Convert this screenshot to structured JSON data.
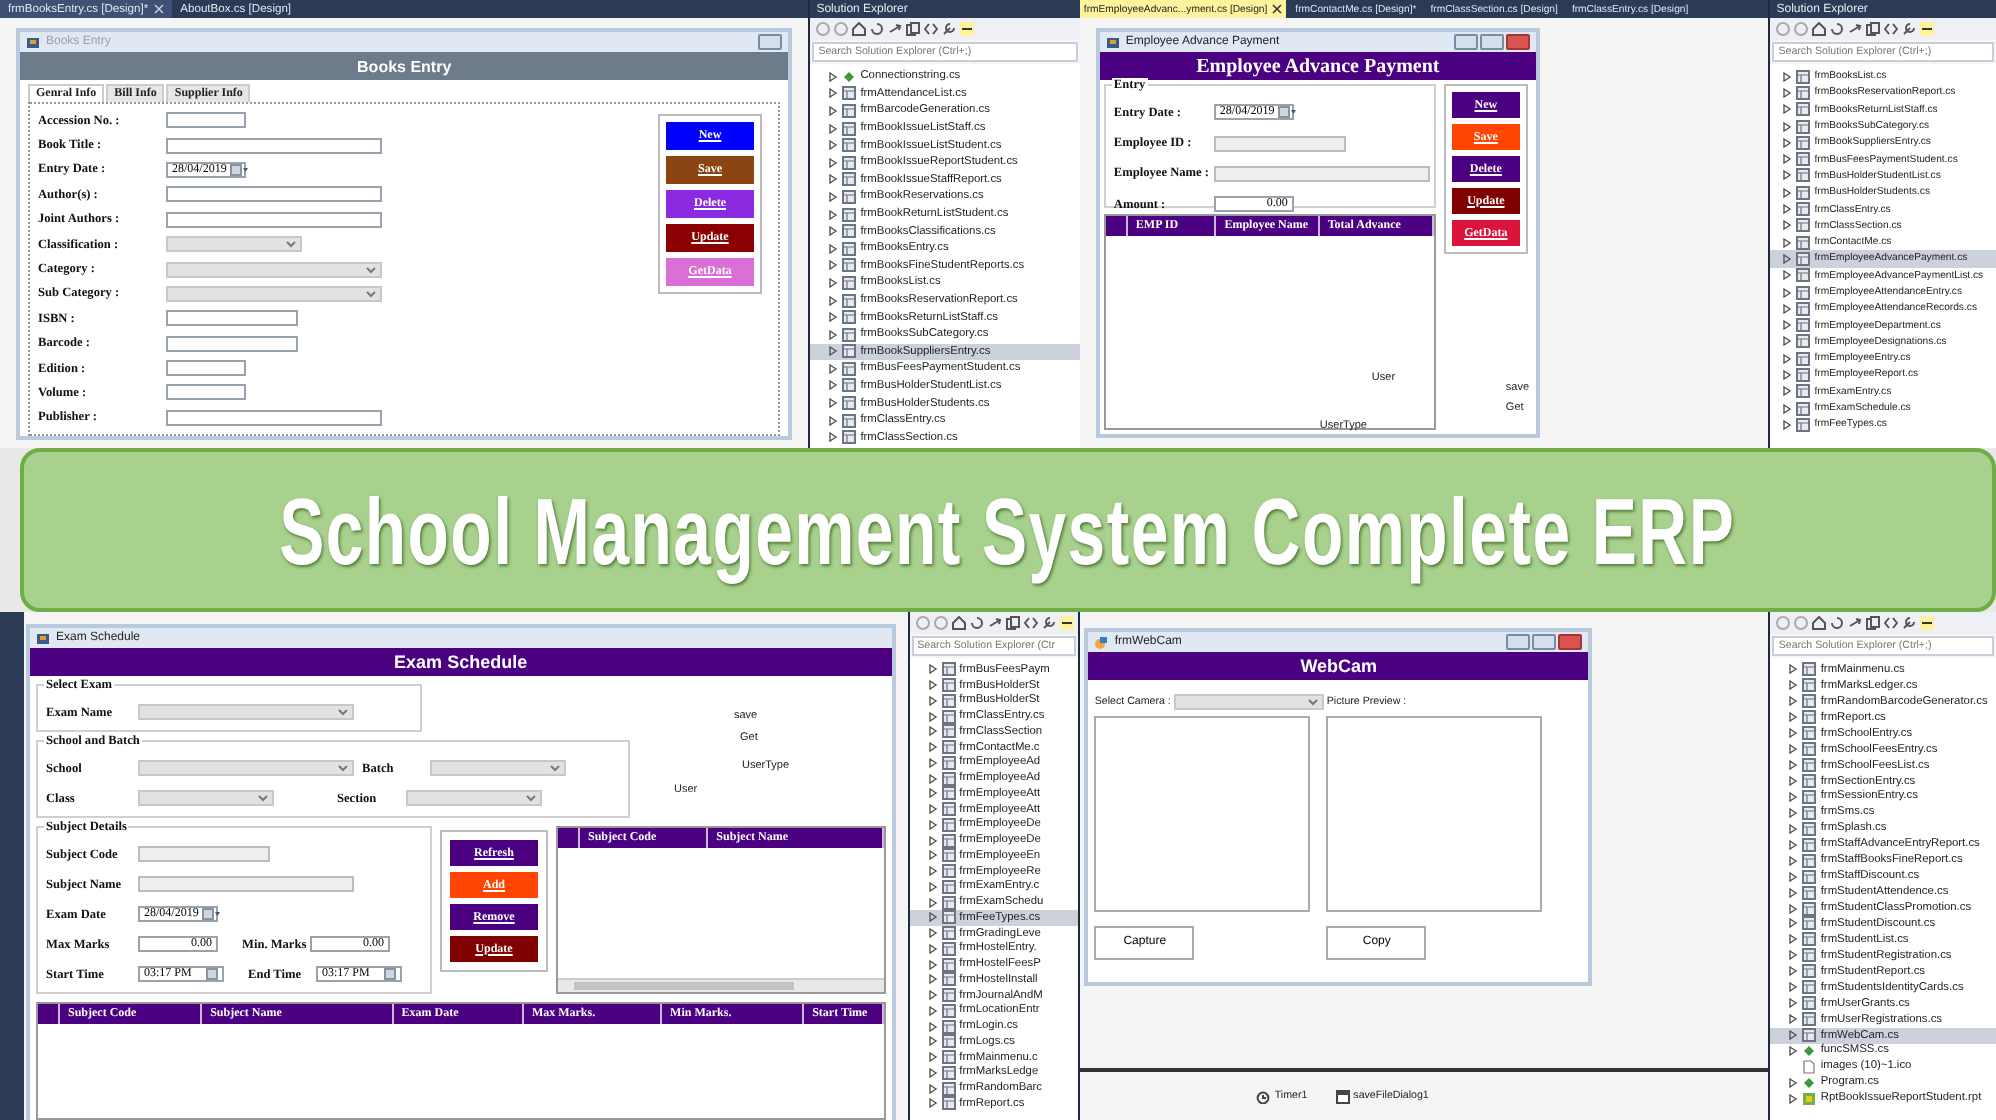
{
  "books_pane": {
    "doc_tabs": [
      {
        "label": "frmBooksEntry.cs [Design]*",
        "selected": true
      },
      {
        "label": "AboutBox.cs [Design]",
        "selected": false
      }
    ],
    "form": {
      "title": "Books Entry",
      "header": "Books Entry",
      "tabs": [
        {
          "label": "Genral Info",
          "selected": true
        },
        {
          "label": "Bill Info",
          "selected": false
        },
        {
          "label": "Supplier Info",
          "selected": false
        }
      ],
      "fields": [
        {
          "label": "Accession No. :",
          "kind": "text-s"
        },
        {
          "label": "Book Title :",
          "kind": "text-l"
        },
        {
          "label": "Entry Date :",
          "kind": "date",
          "value": "28/04/2019"
        },
        {
          "label": "Author(s) :",
          "kind": "text-l"
        },
        {
          "label": "Joint Authors :",
          "kind": "text-l"
        },
        {
          "label": "Classification :",
          "kind": "combo-m"
        },
        {
          "label": "Category :",
          "kind": "combo-l"
        },
        {
          "label": "Sub Category :",
          "kind": "combo-l"
        },
        {
          "label": "ISBN :",
          "kind": "text-m"
        },
        {
          "label": "Barcode :",
          "kind": "text-m"
        },
        {
          "label": "Edition :",
          "kind": "text-s"
        },
        {
          "label": "Volume :",
          "kind": "text-s"
        },
        {
          "label": "Publisher :",
          "kind": "text-l"
        }
      ],
      "buttons": [
        {
          "label": "New",
          "color": "#0000ff"
        },
        {
          "label": "Save",
          "color": "#8b4513"
        },
        {
          "label": "Delete",
          "color": "#8a2be2"
        },
        {
          "label": "Update",
          "color": "#8b0000"
        },
        {
          "label": "GetData",
          "color": "#da70d6"
        }
      ]
    }
  },
  "explorer_top_left": {
    "title": "Solution Explorer",
    "search": {
      "placeholder": "Search Solution Explorer (Ctrl+;)"
    },
    "items": [
      {
        "name": "Connectionstring.cs",
        "kind": "class",
        "selected": false
      },
      {
        "name": "frmAttendanceList.cs",
        "kind": "form",
        "selected": false
      },
      {
        "name": "frmBarcodeGeneration.cs",
        "kind": "form",
        "selected": false
      },
      {
        "name": "frmBookIssueListStaff.cs",
        "kind": "form",
        "selected": false
      },
      {
        "name": "frmBookIssueListStudent.cs",
        "kind": "form",
        "selected": false
      },
      {
        "name": "frmBookIssueReportStudent.cs",
        "kind": "form",
        "selected": false
      },
      {
        "name": "frmBookIssueStaffReport.cs",
        "kind": "form",
        "selected": false
      },
      {
        "name": "frmBookReservations.cs",
        "kind": "form",
        "selected": false
      },
      {
        "name": "frmBookReturnListStudent.cs",
        "kind": "form",
        "selected": false
      },
      {
        "name": "frmBooksClassifications.cs",
        "kind": "form",
        "selected": false
      },
      {
        "name": "frmBooksEntry.cs",
        "kind": "form",
        "selected": false
      },
      {
        "name": "frmBooksFineStudentReports.cs",
        "kind": "form",
        "selected": false
      },
      {
        "name": "frmBooksList.cs",
        "kind": "form",
        "selected": false
      },
      {
        "name": "frmBooksReservationReport.cs",
        "kind": "form",
        "selected": false
      },
      {
        "name": "frmBooksReturnListStaff.cs",
        "kind": "form",
        "selected": false
      },
      {
        "name": "frmBooksSubCategory.cs",
        "kind": "form",
        "selected": false
      },
      {
        "name": "frmBookSuppliersEntry.cs",
        "kind": "form",
        "selected": true
      },
      {
        "name": "frmBusFeesPaymentStudent.cs",
        "kind": "form",
        "selected": false
      },
      {
        "name": "frmBusHolderStudentList.cs",
        "kind": "form",
        "selected": false
      },
      {
        "name": "frmBusHolderStudents.cs",
        "kind": "form",
        "selected": false
      },
      {
        "name": "frmClassEntry.cs",
        "kind": "form",
        "selected": false
      },
      {
        "name": "frmClassSection.cs",
        "kind": "form",
        "selected": false
      }
    ]
  },
  "advance_pane": {
    "doc_tabs": [
      {
        "label": "frmEmployeeAdvanc...yment.cs [Design]",
        "selected": true
      },
      {
        "label": "frmContactMe.cs [Design]*",
        "selected": false
      },
      {
        "label": "frmClassSection.cs [Design]",
        "selected": false
      },
      {
        "label": "frmClassEntry.cs [Design]",
        "selected": false
      }
    ],
    "form": {
      "title": "Employee Advance Payment",
      "header": "Employee Advance Payment",
      "group": "Entry",
      "fields": [
        {
          "label": "Entry Date :",
          "kind": "date",
          "value": "28/04/2019",
          "disabled": false
        },
        {
          "label": "Employee ID :",
          "kind": "text-m",
          "disabled": true
        },
        {
          "label": "Employee Name :",
          "kind": "text-l",
          "disabled": true
        },
        {
          "label": "Amount :",
          "kind": "number",
          "value": "0.00",
          "disabled": false
        }
      ],
      "buttons": [
        {
          "label": "New",
          "color": "#4b0082"
        },
        {
          "label": "Save",
          "color": "#ff4500"
        },
        {
          "label": "Delete",
          "color": "#4b0082"
        },
        {
          "label": "Update",
          "color": "#800000"
        },
        {
          "label": "GetData",
          "color": "#dc143c"
        }
      ],
      "grid_columns": [
        "EMP ID",
        "Employee Name",
        "Total Advance"
      ],
      "designer_labels": [
        "User",
        "save",
        "Get",
        "UserType"
      ]
    }
  },
  "explorer_top_right": {
    "title": "Solution Explorer",
    "search": {
      "placeholder": "Search Solution Explorer (Ctrl+;)"
    },
    "items": [
      {
        "name": "frmBooksList.cs",
        "kind": "form",
        "selected": false
      },
      {
        "name": "frmBooksReservationReport.cs",
        "kind": "form",
        "selected": false
      },
      {
        "name": "frmBooksReturnListStaff.cs",
        "kind": "form",
        "selected": false
      },
      {
        "name": "frmBooksSubCategory.cs",
        "kind": "form",
        "selected": false
      },
      {
        "name": "frmBookSuppliersEntry.cs",
        "kind": "form",
        "selected": false
      },
      {
        "name": "frmBusFeesPaymentStudent.cs",
        "kind": "form",
        "selected": false
      },
      {
        "name": "frmBusHolderStudentList.cs",
        "kind": "form",
        "selected": false
      },
      {
        "name": "frmBusHolderStudents.cs",
        "kind": "form",
        "selected": false
      },
      {
        "name": "frmClassEntry.cs",
        "kind": "form",
        "selected": false
      },
      {
        "name": "frmClassSection.cs",
        "kind": "form",
        "selected": false
      },
      {
        "name": "frmContactMe.cs",
        "kind": "form",
        "selected": false
      },
      {
        "name": "frmEmployeeAdvancePayment.cs",
        "kind": "form",
        "selected": true
      },
      {
        "name": "frmEmployeeAdvancePaymentList.cs",
        "kind": "form",
        "selected": false
      },
      {
        "name": "frmEmployeeAttendanceEntry.cs",
        "kind": "form",
        "selected": false
      },
      {
        "name": "frmEmployeeAttendanceRecords.cs",
        "kind": "form",
        "selected": false
      },
      {
        "name": "frmEmployeeDepartment.cs",
        "kind": "form",
        "selected": false
      },
      {
        "name": "frmEmployeeDesignations.cs",
        "kind": "form",
        "selected": false
      },
      {
        "name": "frmEmployeeEntry.cs",
        "kind": "form",
        "selected": false
      },
      {
        "name": "frmEmployeeReport.cs",
        "kind": "form",
        "selected": false
      },
      {
        "name": "frmExamEntry.cs",
        "kind": "form",
        "selected": false
      },
      {
        "name": "frmExamSchedule.cs",
        "kind": "form",
        "selected": false
      },
      {
        "name": "frmFeeTypes.cs",
        "kind": "form",
        "selected": false
      }
    ]
  },
  "banner": {
    "text": "School Management System Complete ERP"
  },
  "exam_pane": {
    "form": {
      "title": "Exam Schedule",
      "header": "Exam Schedule",
      "groups": [
        {
          "title": "Select Exam",
          "rows": [
            [
              {
                "label": "Exam Name",
                "kind": "combo-l"
              }
            ]
          ]
        },
        {
          "title": "School and Batch",
          "rows": [
            [
              {
                "label": "School",
                "kind": "combo-l"
              },
              {
                "label": "Batch",
                "kind": "combo-m"
              }
            ],
            [
              {
                "label": "Class",
                "kind": "combo-s"
              },
              {
                "label": "Section",
                "kind": "combo-m"
              }
            ]
          ]
        },
        {
          "title": "Subject Details",
          "rows": [
            [
              {
                "label": "Subject Code",
                "kind": "text-m",
                "disabled": true
              }
            ],
            [
              {
                "label": "Subject Name",
                "kind": "text-l",
                "disabled": true
              }
            ],
            [
              {
                "label": "Exam Date",
                "kind": "date",
                "value": "28/04/2019",
                "disabled": false
              }
            ],
            [
              {
                "label": "Max Marks",
                "kind": "number",
                "value": "0.00",
                "disabled": false
              },
              {
                "label": "Min. Marks",
                "kind": "number",
                "value": "0.00",
                "disabled": false
              }
            ],
            [
              {
                "label": "Start Time",
                "kind": "time",
                "value": "03:17 PM",
                "disabled": false
              },
              {
                "label": "End Time",
                "kind": "time",
                "value": "03:17 PM",
                "disabled": false
              }
            ]
          ]
        }
      ],
      "buttons": [
        {
          "label": "Refresh",
          "color": "#4b0082"
        },
        {
          "label": "Add",
          "color": "#ff4500"
        },
        {
          "label": "Remove",
          "color": "#4b0082"
        },
        {
          "label": "Update",
          "color": "#800000"
        }
      ],
      "subject_grid_columns": [
        "Subject Code",
        "Subject Name"
      ],
      "schedule_grid_columns": [
        "Subject Code",
        "Subject Name",
        "Exam Date",
        "Max Marks.",
        "Min Marks.",
        "Start Time"
      ],
      "designer_labels": [
        "save",
        "Get",
        "UserType",
        "User"
      ]
    }
  },
  "explorer_bottom_left": {
    "search": {
      "placeholder": "Search Solution Explorer (Ctr"
    },
    "items": [
      {
        "name": "frmBusFeesPaym",
        "kind": "form",
        "selected": false
      },
      {
        "name": "frmBusHolderSt",
        "kind": "form",
        "selected": false
      },
      {
        "name": "frmBusHolderSt",
        "kind": "form",
        "selected": false
      },
      {
        "name": "frmClassEntry.cs",
        "kind": "form",
        "selected": false
      },
      {
        "name": "frmClassSection",
        "kind": "form",
        "selected": false
      },
      {
        "name": "frmContactMe.c",
        "kind": "form",
        "selected": false
      },
      {
        "name": "frmEmployeeAd",
        "kind": "form",
        "selected": false
      },
      {
        "name": "frmEmployeeAd",
        "kind": "form",
        "selected": false
      },
      {
        "name": "frmEmployeeAtt",
        "kind": "form",
        "selected": false
      },
      {
        "name": "frmEmployeeAtt",
        "kind": "form",
        "selected": false
      },
      {
        "name": "frmEmployeeDe",
        "kind": "form",
        "selected": false
      },
      {
        "name": "frmEmployeeDe",
        "kind": "form",
        "selected": false
      },
      {
        "name": "frmEmployeeEn",
        "kind": "form",
        "selected": false
      },
      {
        "name": "frmEmployeeRe",
        "kind": "form",
        "selected": false
      },
      {
        "name": "frmExamEntry.c",
        "kind": "form",
        "selected": false
      },
      {
        "name": "frmExamSchedu",
        "kind": "form",
        "selected": false
      },
      {
        "name": "frmFeeTypes.cs",
        "kind": "form",
        "selected": true
      },
      {
        "name": "frmGradingLeve",
        "kind": "form",
        "selected": false
      },
      {
        "name": "frmHostelEntry.",
        "kind": "form",
        "selected": false
      },
      {
        "name": "frmHostelFeesP",
        "kind": "form",
        "selected": false
      },
      {
        "name": "frmHostelInstall",
        "kind": "form",
        "selected": false
      },
      {
        "name": "frmJournalAndM",
        "kind": "form",
        "selected": false
      },
      {
        "name": "frmLocationEntr",
        "kind": "form",
        "selected": false
      },
      {
        "name": "frmLogin.cs",
        "kind": "form",
        "selected": false
      },
      {
        "name": "frmLogs.cs",
        "kind": "form",
        "selected": false
      },
      {
        "name": "frmMainmenu.c",
        "kind": "form",
        "selected": false
      },
      {
        "name": "frmMarksLedge",
        "kind": "form",
        "selected": false
      },
      {
        "name": "frmRandomBarc",
        "kind": "form",
        "selected": false
      },
      {
        "name": "frmReport.cs",
        "kind": "form",
        "selected": false
      }
    ]
  },
  "webcam_pane": {
    "form": {
      "title": "frmWebCam",
      "header": "WebCam",
      "camera_label": "Select Camera :",
      "preview_label": "Picture Preview :",
      "buttons": [
        "Capture",
        "Copy"
      ]
    },
    "components": [
      "Timer1",
      "saveFileDialog1"
    ]
  },
  "explorer_bottom_right": {
    "search": {
      "placeholder": "Search Solution Explorer (Ctrl+;)"
    },
    "items": [
      {
        "name": "frmMainmenu.cs",
        "kind": "form",
        "selected": false
      },
      {
        "name": "frmMarksLedger.cs",
        "kind": "form",
        "selected": false
      },
      {
        "name": "frmRandomBarcodeGenerator.cs",
        "kind": "form",
        "selected": false
      },
      {
        "name": "frmReport.cs",
        "kind": "form",
        "selected": false
      },
      {
        "name": "frmSchoolEntry.cs",
        "kind": "form",
        "selected": false
      },
      {
        "name": "frmSchoolFeesEntry.cs",
        "kind": "form",
        "selected": false
      },
      {
        "name": "frmSchoolFeesList.cs",
        "kind": "form",
        "selected": false
      },
      {
        "name": "frmSectionEntry.cs",
        "kind": "form",
        "selected": false
      },
      {
        "name": "frmSessionEntry.cs",
        "kind": "form",
        "selected": false
      },
      {
        "name": "frmSms.cs",
        "kind": "form",
        "selected": false
      },
      {
        "name": "frmSplash.cs",
        "kind": "form",
        "selected": false
      },
      {
        "name": "frmStaffAdvanceEntryReport.cs",
        "kind": "form",
        "selected": false
      },
      {
        "name": "frmStaffBooksFineReport.cs",
        "kind": "form",
        "selected": false
      },
      {
        "name": "frmStaffDiscount.cs",
        "kind": "form",
        "selected": false
      },
      {
        "name": "frmStudentAttendence.cs",
        "kind": "form",
        "selected": false
      },
      {
        "name": "frmStudentClassPromotion.cs",
        "kind": "form",
        "selected": false
      },
      {
        "name": "frmStudentDiscount.cs",
        "kind": "form",
        "selected": false
      },
      {
        "name": "frmStudentList.cs",
        "kind": "form",
        "selected": false
      },
      {
        "name": "frmStudentRegistration.cs",
        "kind": "form",
        "selected": false
      },
      {
        "name": "frmStudentReport.cs",
        "kind": "form",
        "selected": false
      },
      {
        "name": "frmStudentsIdentityCards.cs",
        "kind": "form",
        "selected": false
      },
      {
        "name": "frmUserGrants.cs",
        "kind": "form",
        "selected": false
      },
      {
        "name": "frmUserRegistrations.cs",
        "kind": "form",
        "selected": false
      },
      {
        "name": "frmWebCam.cs",
        "kind": "form",
        "selected": true
      },
      {
        "name": "funcSMSS.cs",
        "kind": "class",
        "selected": false
      },
      {
        "name": "images (10)~1.ico",
        "kind": "icon-file",
        "selected": false
      },
      {
        "name": "Program.cs",
        "kind": "class",
        "selected": false
      },
      {
        "name": "RptBookIssueReportStudent.rpt",
        "kind": "report",
        "selected": false
      }
    ]
  }
}
